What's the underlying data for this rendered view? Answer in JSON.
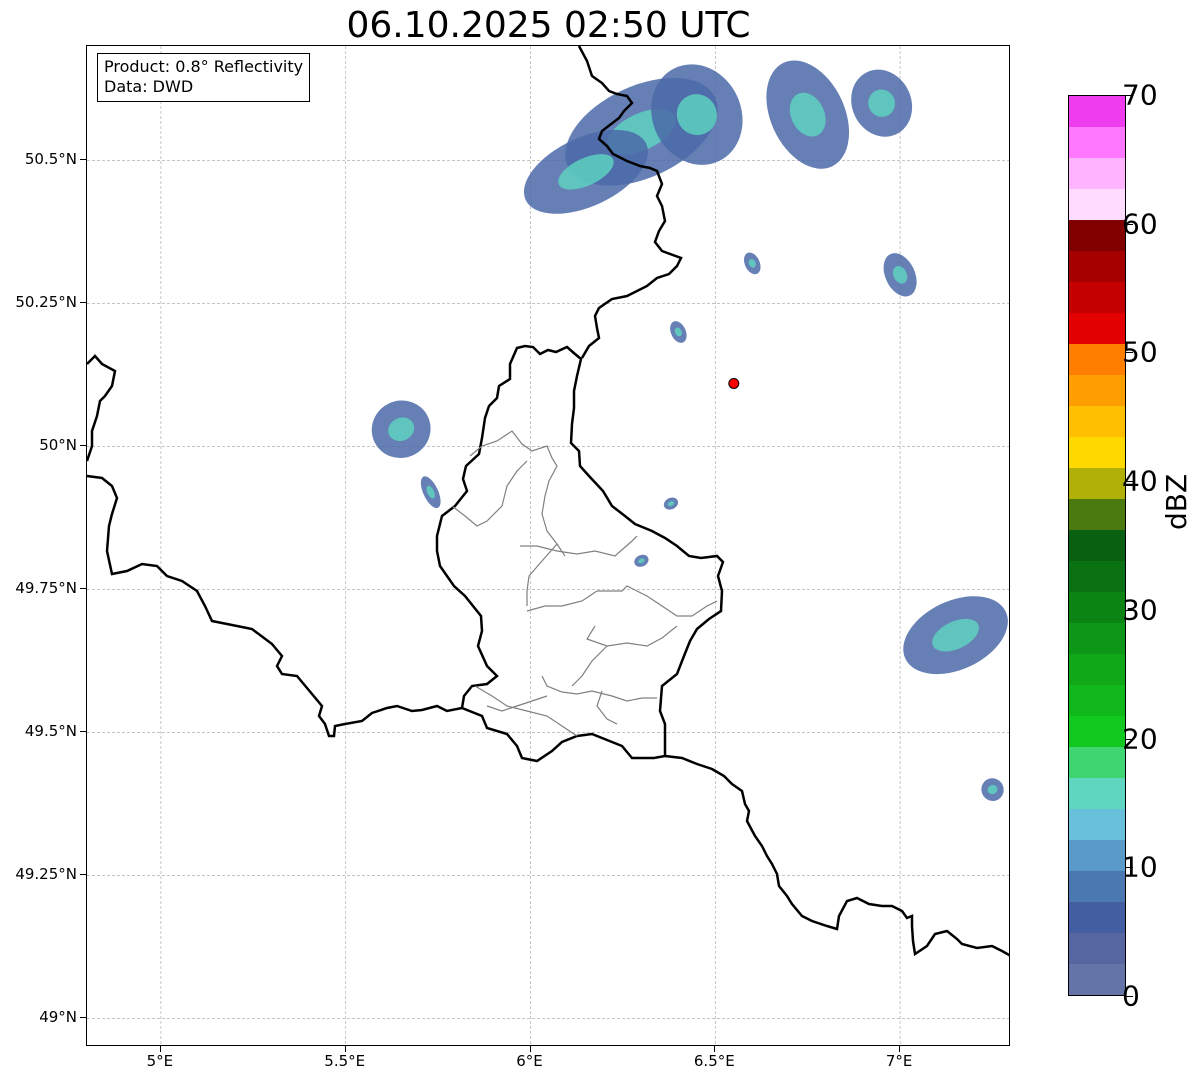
{
  "title": "06.10.2025 02:50 UTC",
  "info": {
    "product": "Product: 0.8° Reflectivity",
    "source": "Data: DWD"
  },
  "map": {
    "lon_range": [
      4.8,
      7.3
    ],
    "lat_range": [
      48.95,
      50.7
    ],
    "x_ticks": [
      {
        "value": 5.0,
        "label": "5°E"
      },
      {
        "value": 5.5,
        "label": "5.5°E"
      },
      {
        "value": 6.0,
        "label": "6°E"
      },
      {
        "value": 6.5,
        "label": "6.5°E"
      },
      {
        "value": 7.0,
        "label": "7°E"
      }
    ],
    "y_ticks": [
      {
        "value": 50.5,
        "label": "50.5°N"
      },
      {
        "value": 50.25,
        "label": "50.25°N"
      },
      {
        "value": 50.0,
        "label": "50°N"
      },
      {
        "value": 49.75,
        "label": "49.75°N"
      },
      {
        "value": 49.5,
        "label": "49.5°N"
      },
      {
        "value": 49.25,
        "label": "49.25°N"
      },
      {
        "value": 49.0,
        "label": "49°N"
      }
    ],
    "grid": "dashed",
    "marker": {
      "lon": 6.55,
      "lat": 50.11,
      "color": "#ff0000"
    },
    "echoes": [
      {
        "lon": 6.3,
        "lat": 50.55,
        "rx": 0.22,
        "ry": 0.08
      },
      {
        "lon": 6.15,
        "lat": 50.48,
        "rx": 0.18,
        "ry": 0.06
      },
      {
        "lon": 6.45,
        "lat": 50.58,
        "rx": 0.12,
        "ry": 0.09
      },
      {
        "lon": 6.75,
        "lat": 50.58,
        "rx": 0.1,
        "ry": 0.1
      },
      {
        "lon": 6.95,
        "lat": 50.6,
        "rx": 0.08,
        "ry": 0.06
      },
      {
        "lon": 7.0,
        "lat": 50.3,
        "rx": 0.04,
        "ry": 0.04
      },
      {
        "lon": 5.65,
        "lat": 50.03,
        "rx": 0.08,
        "ry": 0.05
      },
      {
        "lon": 5.73,
        "lat": 49.92,
        "rx": 0.02,
        "ry": 0.03
      },
      {
        "lon": 7.15,
        "lat": 49.67,
        "rx": 0.15,
        "ry": 0.06
      },
      {
        "lon": 6.4,
        "lat": 50.2,
        "rx": 0.02,
        "ry": 0.02
      },
      {
        "lon": 6.38,
        "lat": 49.9,
        "rx": 0.02,
        "ry": 0.01
      },
      {
        "lon": 6.3,
        "lat": 49.8,
        "rx": 0.02,
        "ry": 0.01
      },
      {
        "lon": 6.6,
        "lat": 50.32,
        "rx": 0.02,
        "ry": 0.02
      },
      {
        "lon": 7.25,
        "lat": 49.4,
        "rx": 0.03,
        "ry": 0.02
      }
    ]
  },
  "colorbar": {
    "unit": "dBZ",
    "min": 0,
    "max": 70,
    "ticks": [
      {
        "value": 0,
        "label": "0"
      },
      {
        "value": 10,
        "label": "10"
      },
      {
        "value": 20,
        "label": "20"
      },
      {
        "value": 30,
        "label": "30"
      },
      {
        "value": 40,
        "label": "40"
      },
      {
        "value": 50,
        "label": "50"
      },
      {
        "value": 60,
        "label": "60"
      },
      {
        "value": 70,
        "label": "70"
      }
    ],
    "colors": [
      "#6474a6",
      "#5566a0",
      "#445ea2",
      "#4b78b0",
      "#5a9ac8",
      "#68c0da",
      "#5ed6c0",
      "#3fd672",
      "#10c81e",
      "#10b81c",
      "#10a818",
      "#0e9616",
      "#0c8414",
      "#0a7212",
      "#086010",
      "#4a7a10",
      "#b0b008",
      "#ffd800",
      "#ffbe00",
      "#ff9e00",
      "#ff7e00",
      "#e20000",
      "#c40000",
      "#a40000",
      "#800000",
      "#ffdcff",
      "#ffb4ff",
      "#ff78ff",
      "#ee3cee"
    ]
  }
}
